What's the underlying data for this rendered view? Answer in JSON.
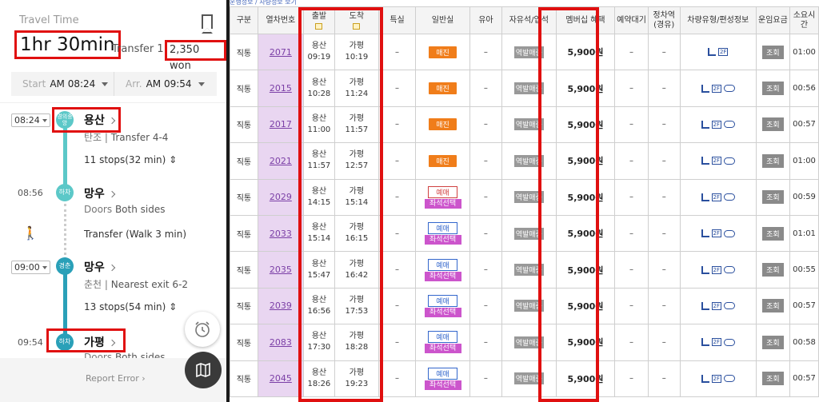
{
  "left": {
    "travel_time_label": "Travel Time",
    "duration": "1hr 30min",
    "transfer": "Transfer 1",
    "fare": "2,350 won",
    "start_label": "Start",
    "start_time": "AM 08:24",
    "arr_label": "Arr.",
    "arr_time": "AM 09:54",
    "stops": [
      {
        "time": "08:24",
        "badge": "경의중앙",
        "name": "용산",
        "sub": "탄조",
        "sub2": "Transfer 4-4"
      },
      {
        "time": "08:56",
        "badge": "하차",
        "name": "망우",
        "sub": "Doors",
        "sub2": "Both sides"
      },
      {
        "time": "09:00",
        "badge": "경춘",
        "name": "망우",
        "sub": "춘천",
        "sub2": "Nearest exit 6-2"
      },
      {
        "time": "09:54",
        "badge": "하차",
        "name": "가평",
        "sub": "Doors",
        "sub2": "Both sides"
      }
    ],
    "segment1": "11 stops(32 min)",
    "walk": "Transfer (Walk 3 min)",
    "segment2": "13 stops(54 min)",
    "report": "Report Error"
  },
  "right": {
    "top_link": "운행정보 / 차량정보 보기",
    "headers": [
      "구분",
      "열차번호",
      "출발",
      "도착",
      "특실",
      "일반실",
      "유아",
      "자유석/입석",
      "멤버십 혜택",
      "예약대기",
      "정차역(경유)",
      "차량유형/편성정보",
      "운임요금",
      "소요시간"
    ],
    "badge_soldout": "매진",
    "badge_reserve": "예매",
    "badge_seat": "좌석선택",
    "badge_free": "역발매중",
    "badge_lookup": "조회",
    "dash": "–",
    "rows": [
      {
        "type": "직통",
        "no": "2071",
        "dep": "용산",
        "dep_t": "09:19",
        "arr": "가평",
        "arr_t": "10:19",
        "status": "soldout",
        "price": "5,900원",
        "time": "01:00",
        "icons": 2
      },
      {
        "type": "직통",
        "no": "2015",
        "dep": "용산",
        "dep_t": "10:28",
        "arr": "가평",
        "arr_t": "11:24",
        "status": "soldout",
        "price": "5,900원",
        "time": "00:56",
        "icons": 3
      },
      {
        "type": "직통",
        "no": "2017",
        "dep": "용산",
        "dep_t": "11:00",
        "arr": "가평",
        "arr_t": "11:57",
        "status": "soldout",
        "price": "5,900원",
        "time": "00:57",
        "icons": 3
      },
      {
        "type": "직통",
        "no": "2021",
        "dep": "용산",
        "dep_t": "11:57",
        "arr": "가평",
        "arr_t": "12:57",
        "status": "soldout",
        "price": "5,900원",
        "time": "01:00",
        "icons": 3
      },
      {
        "type": "직통",
        "no": "2029",
        "dep": "용산",
        "dep_t": "14:15",
        "arr": "가평",
        "arr_t": "15:14",
        "status": "reserve_red",
        "price": "5,900원",
        "time": "00:59",
        "icons": 3
      },
      {
        "type": "직통",
        "no": "2033",
        "dep": "용산",
        "dep_t": "15:14",
        "arr": "가평",
        "arr_t": "16:15",
        "status": "reserve",
        "price": "5,900원",
        "time": "01:01",
        "icons": 3
      },
      {
        "type": "직통",
        "no": "2035",
        "dep": "용산",
        "dep_t": "15:47",
        "arr": "가평",
        "arr_t": "16:42",
        "status": "reserve",
        "price": "5,900원",
        "time": "00:55",
        "icons": 3
      },
      {
        "type": "직통",
        "no": "2039",
        "dep": "용산",
        "dep_t": "16:56",
        "arr": "가평",
        "arr_t": "17:53",
        "status": "reserve",
        "price": "5,900원",
        "time": "00:57",
        "icons": 3
      },
      {
        "type": "직통",
        "no": "2083",
        "dep": "용산",
        "dep_t": "17:30",
        "arr": "가평",
        "arr_t": "18:28",
        "status": "reserve",
        "price": "5,900원",
        "time": "00:58",
        "icons": 3
      },
      {
        "type": "직통",
        "no": "2045",
        "dep": "용산",
        "dep_t": "18:26",
        "arr": "가평",
        "arr_t": "19:23",
        "status": "reserve",
        "price": "5,900원",
        "time": "00:57",
        "icons": 3
      }
    ]
  },
  "colors": {
    "highlight": "#e01010",
    "line1": "#5cc8c8",
    "line2": "#2aa0b8",
    "soldout": "#f07d1a",
    "seat": "#cc55cc"
  }
}
